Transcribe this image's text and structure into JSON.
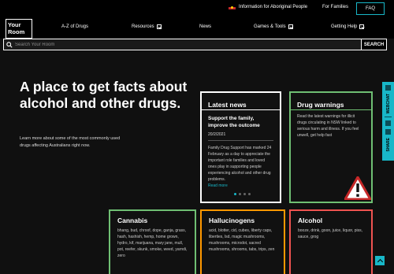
{
  "utility": {
    "aboriginal_label": "Information for Aboriginal People",
    "families_label": "For Families",
    "faq_label": "FAQ"
  },
  "logo": {
    "line1": "Your",
    "line2": "Room"
  },
  "nav": {
    "az": "A-Z of Drugs",
    "resources": "Resources",
    "news": "News",
    "games": "Games & Tools",
    "help": "Getting Help"
  },
  "search": {
    "placeholder": "Search Your Room",
    "button": "SEARCH"
  },
  "hero": {
    "title": "A place to get facts about alcohol and other drugs.",
    "subtitle": "Learn more about some of the most commonly used drugs affecting Australians right now."
  },
  "news": {
    "heading": "Latest news",
    "article_title": "Support the family, improve the outcome",
    "date": "20/2/2021",
    "excerpt": "Family Drug Support has marked 24 February as a day to appreciate the important role families and loved ones play in supporting people experiencing alcohol and other drug problems.",
    "read_more": "Read more"
  },
  "warnings": {
    "heading": "Drug warnings",
    "text": "Read the latest warnings for illicit drugs circulating in NSW linked to serious harm and illness. If you feel unwell, get help fast"
  },
  "cards": [
    {
      "title": "Cannabis",
      "text": "bhang, bud, chroof, dope, ganja, grass, hash, hashish, hemp, home grown, hydro, kif, marijuana, mary jane, mull, pot, reefer, skunk, smoke, weed, yarndi, zero"
    },
    {
      "title": "Hallucinogens",
      "text": "acid, blotter, cid, cubes, liberty caps, liberties, lsd, magic mushrooms, mushrooms, microdot, sacred mushrooms, shrooms, tabs, trips, zen"
    },
    {
      "title": "Alcohol",
      "text": "booze, drink, goon, juice, liquor, piss, sauce, grog"
    }
  ],
  "share": {
    "label1": "WEBCHAT",
    "label2": "SHARE"
  },
  "colors": {
    "accent": "#18b7c8",
    "green": "#6fbf73",
    "orange": "#ff9800",
    "red": "#ef5350"
  }
}
